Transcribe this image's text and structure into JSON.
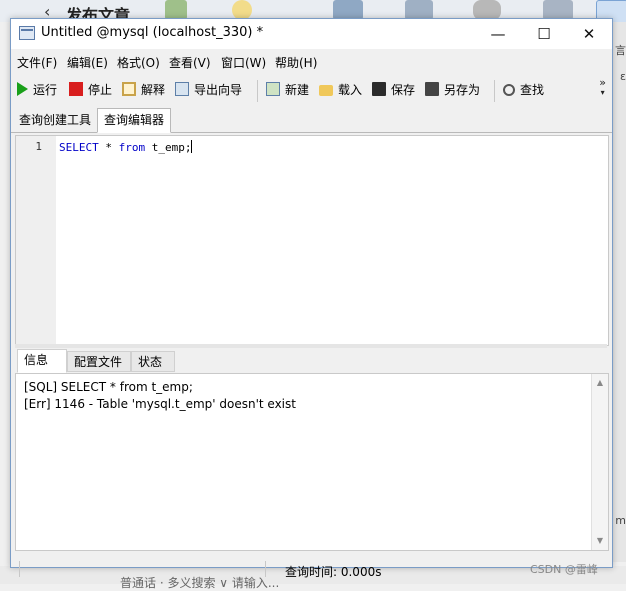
{
  "background": {
    "back_glyph": "‹",
    "title": "发布文章",
    "right_texts": [
      "言",
      "ε",
      "m"
    ],
    "bottom_text": "普通话 · 多义搜索 ∨      请输入..."
  },
  "window": {
    "title": "Untitled @mysql (localhost_330) *",
    "controls": {
      "minimize": "—",
      "maximize": "☐",
      "close": "✕"
    }
  },
  "menu": [
    {
      "label": "文件(F)"
    },
    {
      "label": "编辑(E)"
    },
    {
      "label": "格式(O)"
    },
    {
      "label": "查看(V)"
    },
    {
      "label": "窗口(W)"
    },
    {
      "label": "帮助(H)"
    }
  ],
  "toolbar": {
    "run": "运行",
    "stop": "停止",
    "explain": "解释",
    "export_wizard": "导出向导",
    "new": "新建",
    "load": "载入",
    "save": "保存",
    "save_as": "另存为",
    "find": "查找",
    "more": "»"
  },
  "tabs": {
    "query_builder": "查询创建工具",
    "query_editor": "查询编辑器"
  },
  "editor": {
    "line_number": "1",
    "keyword_select": "SELECT",
    "star": " * ",
    "keyword_from": "from",
    "rest": " t_emp;"
  },
  "bottom_tabs": {
    "info": "信息",
    "profile": "配置文件",
    "status": "状态"
  },
  "messages": [
    "[SQL] SELECT * from t_emp;",
    "[Err] 1146 - Table 'mysql.t_emp' doesn't exist"
  ],
  "statusbar": {
    "query_time": "查询时间: 0.000s"
  },
  "watermark": "CSDN @雷峰",
  "colors": {
    "keyword": "#0000c8",
    "run_icon": "#1aa01a",
    "stop_icon": "#d81e1e",
    "window_border": "#7a9cc6"
  }
}
